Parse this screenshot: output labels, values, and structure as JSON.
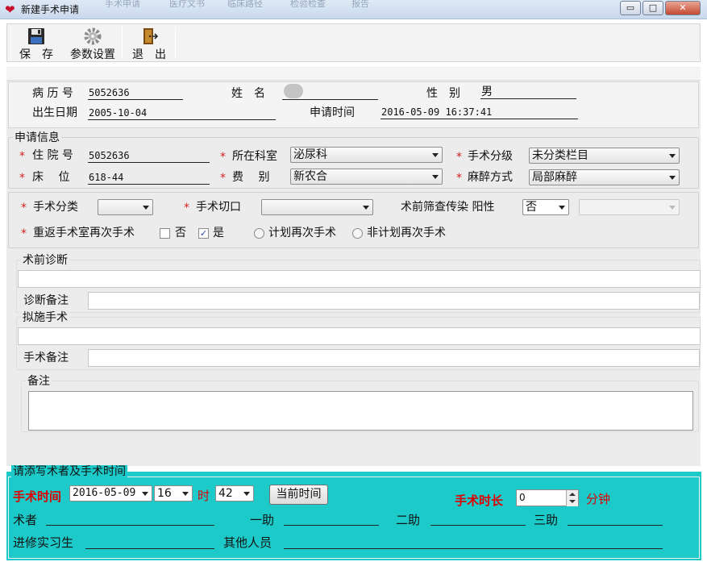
{
  "window": {
    "title": "新建手术申请",
    "ghost_tabs": [
      "手术申请",
      "医疗文书",
      "临床路径",
      "检验检查",
      "报告"
    ],
    "minimize": "▭",
    "maximize": "□",
    "close": "✕"
  },
  "toolbar": {
    "save": "保　存",
    "params": "参数设置",
    "exit": "退　出"
  },
  "patient": {
    "record_no_label": "病 历 号",
    "record_no": "5052636",
    "name_label": "姓　名",
    "name": "",
    "gender_label": "性　别",
    "gender": "男",
    "birth_label": "出生日期",
    "birth": "2005-10-04",
    "apply_time_label": "申请时间",
    "apply_time": "2016-05-09 16:37:41"
  },
  "apply": {
    "group_title": "申请信息",
    "inpatient_no_label": "住 院 号",
    "inpatient_no": "5052636",
    "dept_label": "所在科室",
    "dept": "泌尿科",
    "grade_label": "手术分级",
    "grade": "未分类栏目",
    "bed_label": "床　 位",
    "bed": "618-44",
    "fee_label": "费　 别",
    "fee": "新农合",
    "anesthesia_label": "麻醉方式",
    "anesthesia": "局部麻醉",
    "category_label": "手术分类",
    "category": "",
    "incision_label": "手术切口",
    "incision": "",
    "screening_label": "术前筛查传染 阳性",
    "screening": "否",
    "screening_detail": "",
    "return_label": "重返手术室再次手术",
    "no_label": "否",
    "yes_label": "是",
    "planned_label": "计划再次手术",
    "unplanned_label": "非计划再次手术",
    "yes_checked": "✓"
  },
  "diagnosis": {
    "title": "术前诊断",
    "value": "",
    "note_label": "诊断备注",
    "note": ""
  },
  "surgery": {
    "title": "拟施手术",
    "value": "",
    "note_label": "手术备注",
    "note": ""
  },
  "remark": {
    "title": "备注",
    "value": ""
  },
  "staff": {
    "group_title": "请添写术者及手术时间",
    "time_label": "手术时间",
    "date": "2016-05-09",
    "hour": "16",
    "hour_unit": "时",
    "minute": "42",
    "now_button": "当前时间",
    "duration_label": "手术时长",
    "duration": "0",
    "duration_unit": "分钟",
    "surgeon_label": "术者",
    "assist1_label": "一助",
    "assist2_label": "二助",
    "assist3_label": "三助",
    "intern_label": "进修实习生",
    "others_label": "其他人员"
  },
  "colors": {
    "required": "#d61f1f",
    "teal_panel": "#1ccbc9",
    "highlight_red": "#e00000"
  }
}
